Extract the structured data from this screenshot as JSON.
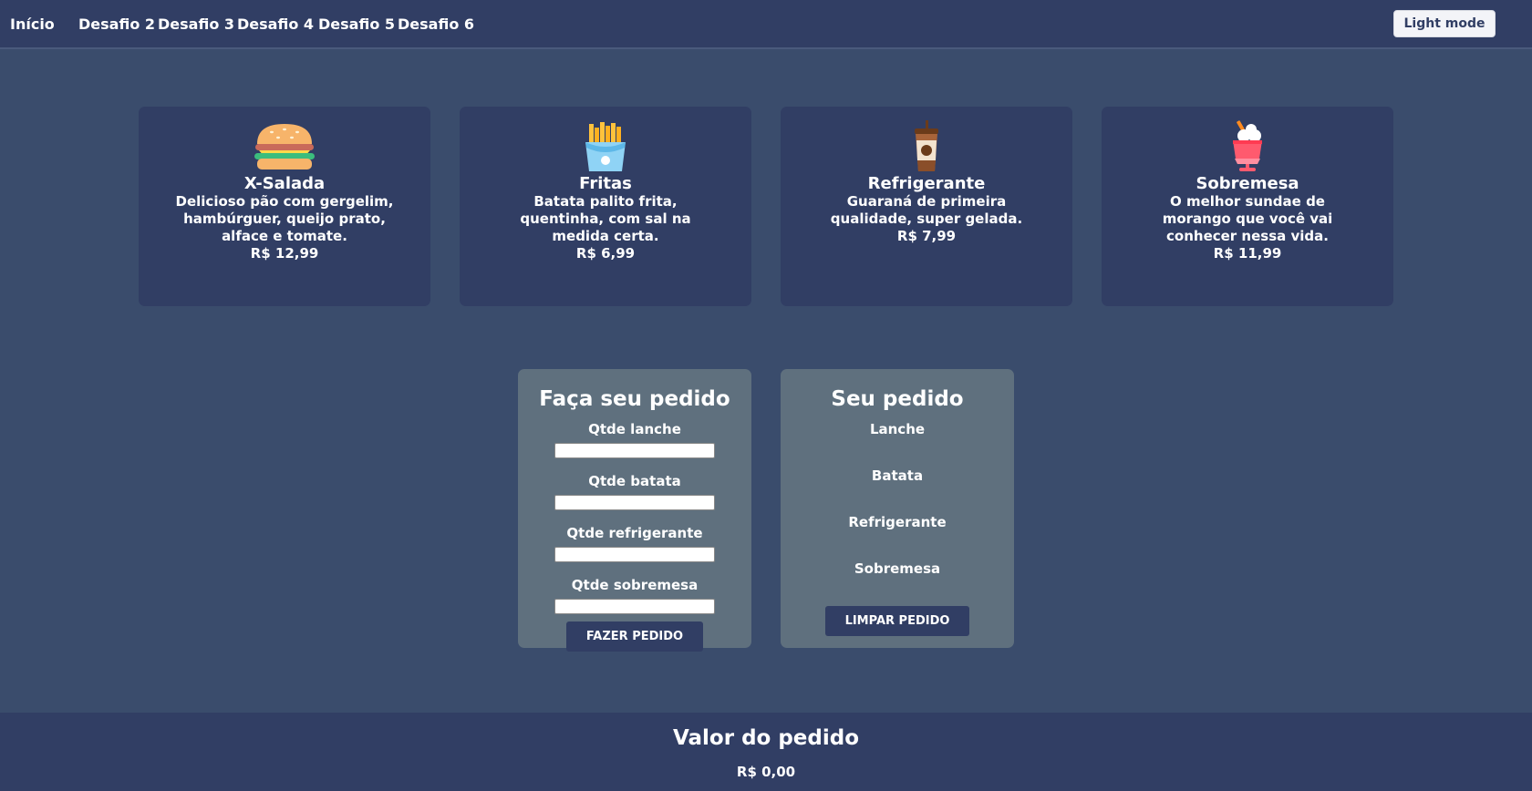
{
  "nav": {
    "links": [
      "Início",
      "Desafio 2",
      "Desafio 3",
      "Desafio 4",
      "Desafio 5",
      "Desafio 6"
    ],
    "theme_button": "Light mode"
  },
  "products": [
    {
      "icon": "sandwich-icon",
      "name": "X-Salada",
      "description": "Delicioso pão com gergelim, hambúrguer, queijo prato, alface e tomate.",
      "price": "R$ 12,99"
    },
    {
      "icon": "fries-icon",
      "name": "Fritas",
      "description": "Batata palito frita, quentinha, com sal na medida certa.",
      "price": "R$ 6,99"
    },
    {
      "icon": "soda-cup-icon",
      "name": "Refrigerante",
      "description": "Guaraná de primeira qualidade, super gelada.",
      "price": "R$ 7,99"
    },
    {
      "icon": "sundae-icon",
      "name": "Sobremesa",
      "description": "O melhor sundae de morango que você vai conhecer nessa vida.",
      "price": "R$ 11,99"
    }
  ],
  "order_form": {
    "title": "Faça seu pedido",
    "fields": [
      {
        "label": "Qtde lanche",
        "value": ""
      },
      {
        "label": "Qtde batata",
        "value": ""
      },
      {
        "label": "Qtde refrigerante",
        "value": ""
      },
      {
        "label": "Qtde sobremesa",
        "value": ""
      }
    ],
    "submit_label": "FAZER PEDIDO"
  },
  "order_summary": {
    "title": "Seu pedido",
    "items": [
      "Lanche",
      "Batata",
      "Refrigerante",
      "Sobremesa"
    ],
    "clear_label": "LIMPAR PEDIDO"
  },
  "footer": {
    "title": "Valor do pedido",
    "total": "R$ 0,00"
  },
  "colors": {
    "background": "#3a4c6c",
    "navbar": "#313e64",
    "card": "#313e64",
    "panel": "#5f707e",
    "text": "#ffffff"
  }
}
